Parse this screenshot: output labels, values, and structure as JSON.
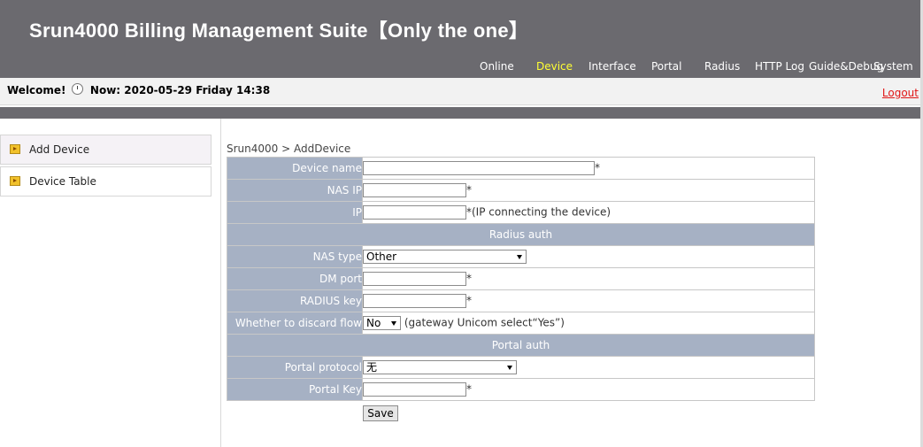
{
  "header": {
    "title": "Srun4000 Billing Management Suite【Only the one】",
    "nav": [
      {
        "label": "Online",
        "active": false
      },
      {
        "label": "Device",
        "active": true
      },
      {
        "label": "Interface",
        "active": false
      },
      {
        "label": "Portal",
        "active": false
      },
      {
        "label": "Radius",
        "active": false
      },
      {
        "label": "HTTP Log",
        "active": false
      },
      {
        "label": "Guide&Debug",
        "active": false
      },
      {
        "label": "System",
        "active": false
      }
    ]
  },
  "welcome_bar": {
    "welcome": "Welcome!",
    "clock_icon": "clock-icon",
    "now": "Now: 2020-05-29 Friday 14:38",
    "logout": "Logout"
  },
  "sidebar": {
    "items": [
      {
        "label": "Add Device",
        "icon": "arrow-right-icon",
        "selected": true
      },
      {
        "label": "Device Table",
        "icon": "arrow-right-icon",
        "selected": false
      }
    ]
  },
  "breadcrumb": "Srun4000 > AddDevice",
  "form": {
    "device_name": {
      "label": "Device name",
      "value": "",
      "required": "*"
    },
    "nas_ip": {
      "label": "NAS IP",
      "value": "",
      "required": "*"
    },
    "ip": {
      "label": "IP",
      "value": "",
      "hint": "*(IP connecting the device)"
    },
    "radius_section": "Radius auth",
    "nas_type": {
      "label": "NAS type",
      "selected": "Other"
    },
    "dm_port": {
      "label": "DM port",
      "value": "",
      "required": "*"
    },
    "radius_key": {
      "label": "RADIUS key",
      "value": "",
      "required": "*"
    },
    "discard_flow": {
      "label": "Whether to discard flow",
      "selected": "No",
      "hint": "(gateway Unicom select“Yes”)"
    },
    "portal_section": "Portal auth",
    "portal_protocol": {
      "label": "Portal protocol",
      "selected": "无"
    },
    "portal_key": {
      "label": "Portal Key",
      "value": "",
      "required": "*"
    },
    "save_label": "Save"
  },
  "colors": {
    "header_bg": "#6b6a6f",
    "active_nav": "#ffff33",
    "label_bg": "#a6b1c4",
    "logout": "#e01515"
  }
}
